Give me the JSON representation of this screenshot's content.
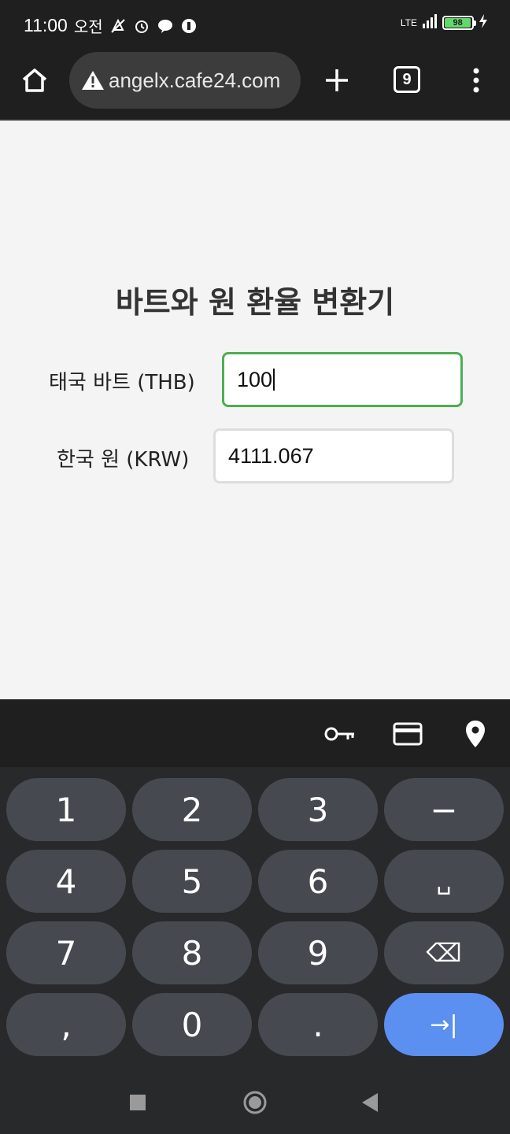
{
  "status_bar": {
    "time": "11:00",
    "ampm": "오전",
    "network": "LTE",
    "battery": "98",
    "battery_level": 0.98,
    "icons": [
      "mute-icon",
      "alarm-icon",
      "talk-icon",
      "notification-icon",
      "signal-icon",
      "battery-icon",
      "charging-icon"
    ]
  },
  "browser": {
    "url": "angelx.cafe24.com",
    "tab_count": "9",
    "icons": [
      "home-icon",
      "warning-icon",
      "plus-icon",
      "tabs-icon",
      "more-icon"
    ]
  },
  "page": {
    "title": "바트와 원 환율 변환기",
    "thb_label": "태국 바트 (THB)",
    "thb_value": "100",
    "krw_label": "한국 원 (KRW)",
    "krw_value": "4111.067"
  },
  "accessory": {
    "icons": [
      "key-icon",
      "credit-card-icon",
      "location-pin-icon"
    ]
  },
  "keyboard": {
    "rows": [
      [
        "1",
        "2",
        "3",
        "−"
      ],
      [
        "4",
        "5",
        "6",
        "␣"
      ],
      [
        "7",
        "8",
        "9",
        "⌫"
      ],
      [
        ",",
        "0",
        ".",
        "→|"
      ]
    ]
  },
  "colors": {
    "focus_border": "#4caf50",
    "action_key": "#5b8ff0",
    "battery_fill": "#63d86b"
  }
}
